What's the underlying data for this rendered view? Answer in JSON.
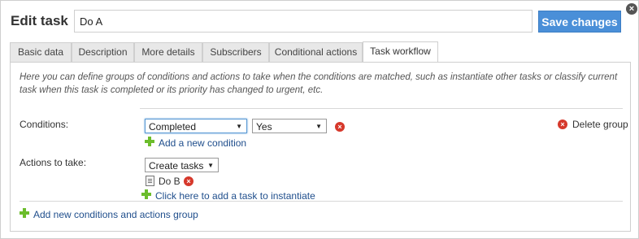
{
  "dialog": {
    "title": "Edit task",
    "task_name": "Do A",
    "save_label": "Save changes"
  },
  "tabs": [
    {
      "label": "Basic data",
      "active": false
    },
    {
      "label": "Description",
      "active": false
    },
    {
      "label": "More details",
      "active": false
    },
    {
      "label": "Subscribers",
      "active": false
    },
    {
      "label": "Conditional actions",
      "active": false
    },
    {
      "label": "Task workflow",
      "active": true
    }
  ],
  "workflow": {
    "intro": "Here you can define groups of conditions and actions to take when the conditions are matched, such as instantiate other tasks or classify current task when this task is completed or its priority has changed to urgent, etc.",
    "conditions_label": "Conditions:",
    "condition_field": "Completed",
    "condition_value": "Yes",
    "add_condition": "Add a new condition",
    "delete_group": "Delete group",
    "actions_label": "Actions to take:",
    "action_type": "Create tasks",
    "task_item": "Do B",
    "add_task": "Click here to add a task to instantiate",
    "add_group": "Add new conditions and actions group"
  },
  "icons": {
    "close": "close-icon",
    "remove": "remove-icon",
    "add": "plus-icon",
    "task": "task-icon"
  },
  "colors": {
    "accent": "#4a8fd8",
    "link": "#1f4e8c",
    "remove": "#d6382b",
    "add": "#6cbd2c"
  }
}
